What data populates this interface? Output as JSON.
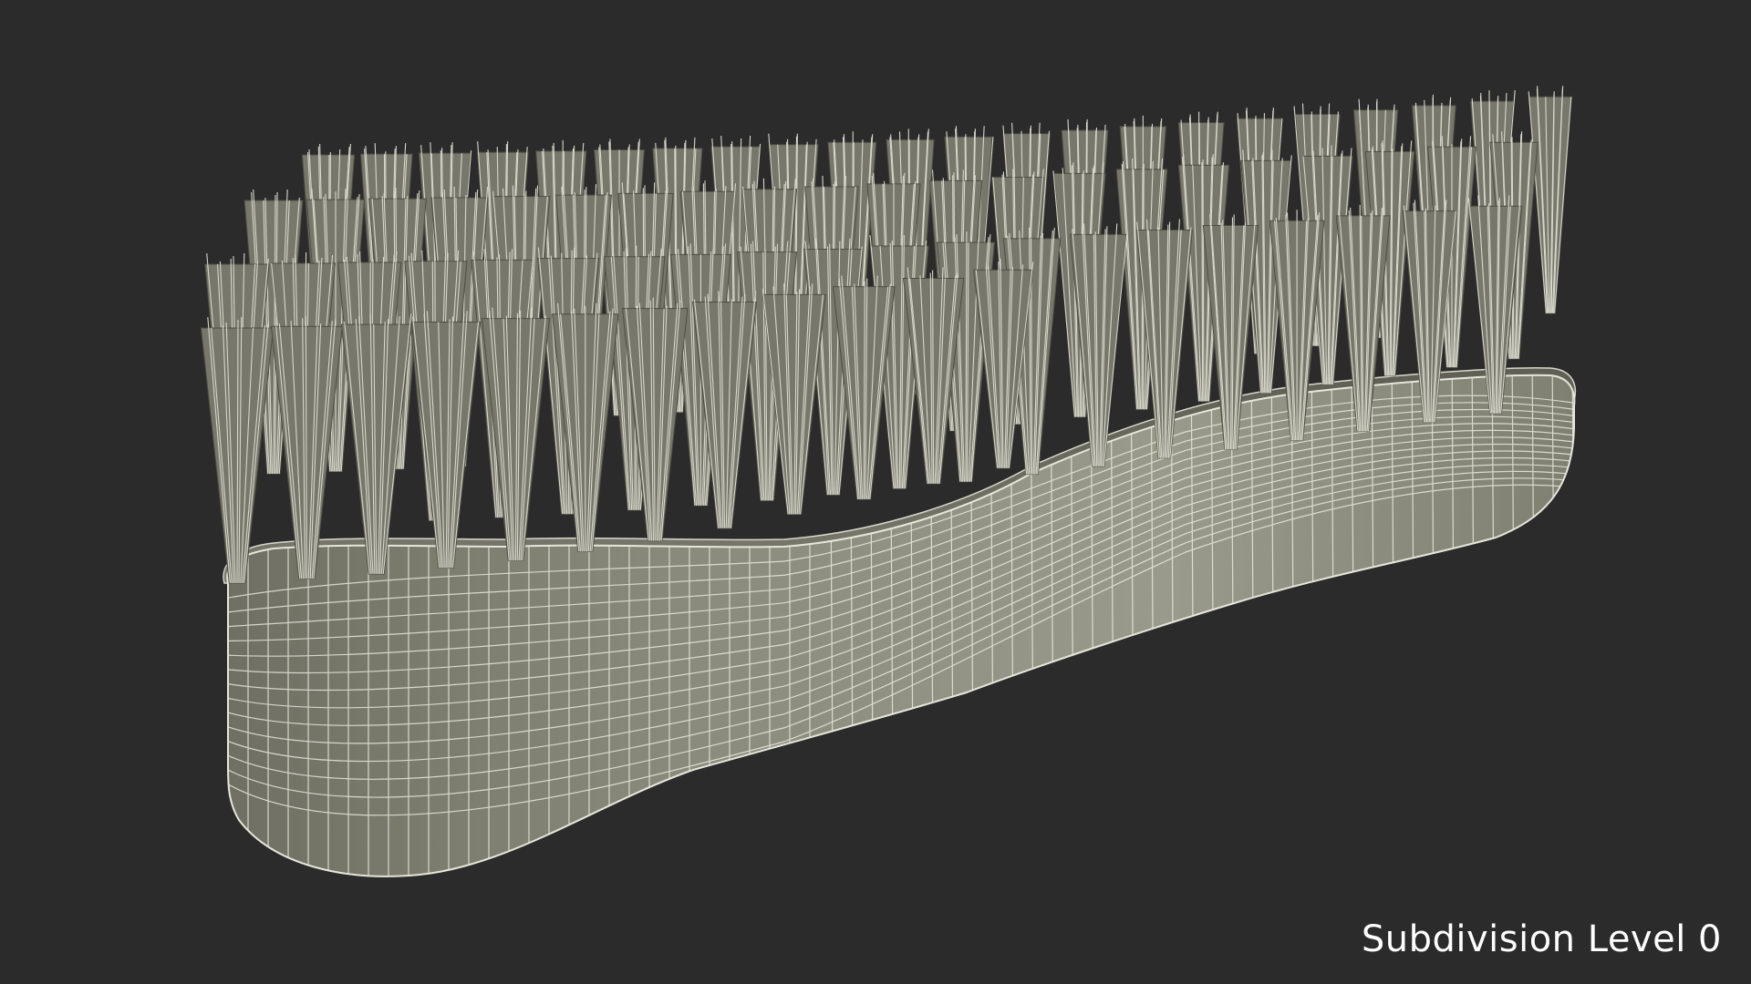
{
  "render": {
    "subject": "scrub-brush-wireframe-model",
    "caption": "Subdivision Level 0"
  },
  "colors": {
    "background": "#2b2b2b",
    "mesh_fill": "#8a8a7c",
    "mesh_dark": "#55554b",
    "wire": "#e6e6da",
    "bristle": "#9a9a8c"
  }
}
